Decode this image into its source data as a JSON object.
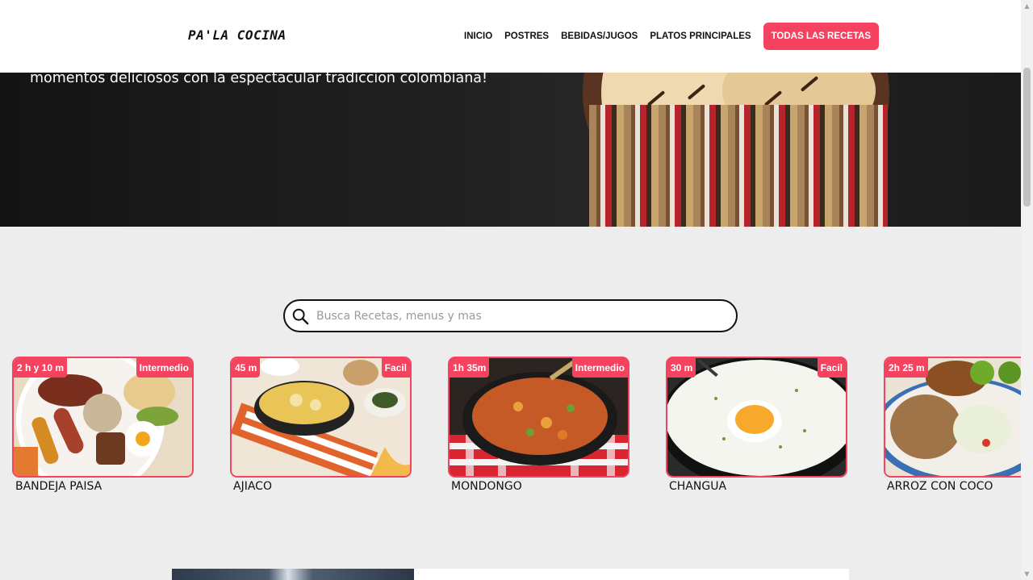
{
  "header": {
    "brand": "PA'LA COCINA",
    "nav": [
      {
        "label": "INICIO"
      },
      {
        "label": "POSTRES"
      },
      {
        "label": "BEBIDAS/JUGOS"
      },
      {
        "label": "PLATOS PRINCIPALES"
      }
    ],
    "cta_label": "TODAS LAS RECETAS"
  },
  "hero": {
    "text": "momentos deliciosos con la espectacular tradiccion colombiana!"
  },
  "search": {
    "placeholder": "Busca Recetas, menus y mas",
    "value": ""
  },
  "recipes": [
    {
      "time": "2 h y 10 m",
      "level": "Intermedio",
      "title": "BANDEJA PAISA"
    },
    {
      "time": "45 m",
      "level": "Facil",
      "title": "AJIACO"
    },
    {
      "time": "1h 35m",
      "level": "Intermedio",
      "title": "MONDONGO"
    },
    {
      "time": "30 m",
      "level": "Facil",
      "title": "CHANGUA"
    },
    {
      "time": "2h 25 m",
      "level": "",
      "title": "ARROZ CON COCO"
    }
  ],
  "colors": {
    "accent": "#f5435f",
    "page_bg": "#ededed",
    "hero_bg": "#1c1c1c"
  }
}
